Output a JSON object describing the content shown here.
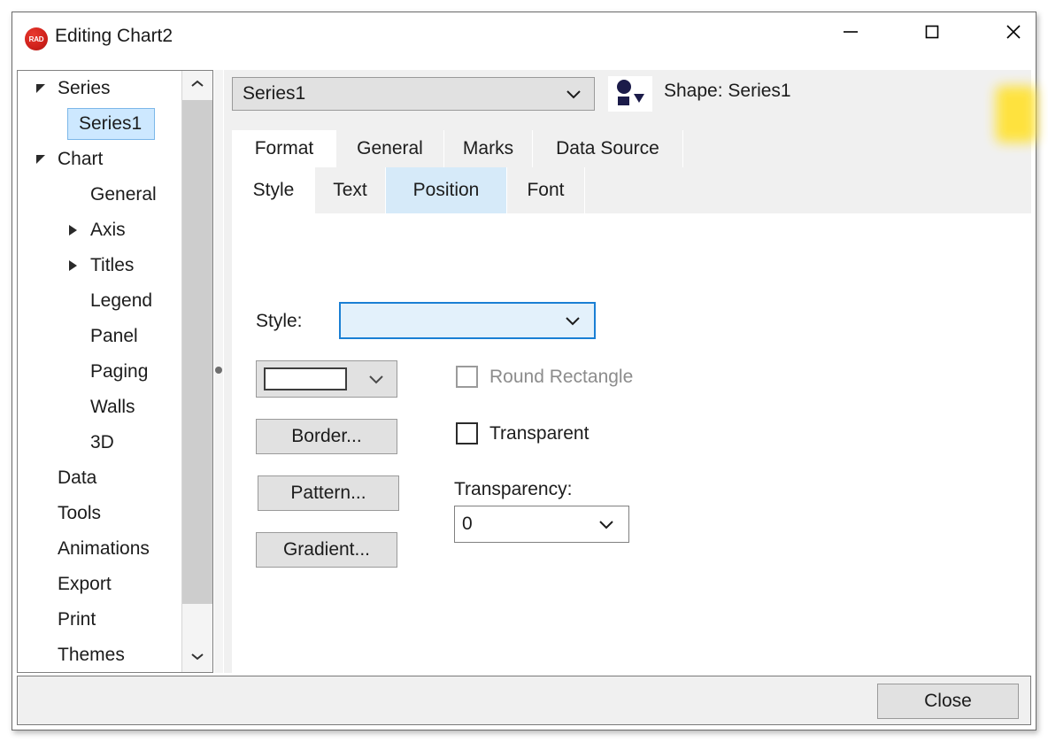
{
  "window": {
    "title": "Editing Chart2",
    "logo_text": "RAD",
    "controls": {
      "minimize": "minimize-icon",
      "maximize": "maximize-icon",
      "close": "close-icon"
    }
  },
  "tree": {
    "items": [
      {
        "label": "Series",
        "level": 0,
        "expander": "expanded",
        "selected": false
      },
      {
        "label": "Series1",
        "level": 1,
        "expander": "none",
        "selected": true
      },
      {
        "label": "Chart",
        "level": 0,
        "expander": "expanded",
        "selected": false
      },
      {
        "label": "General",
        "level": 1,
        "expander": "none",
        "selected": false
      },
      {
        "label": "Axis",
        "level": 1,
        "expander": "collapsed",
        "selected": false
      },
      {
        "label": "Titles",
        "level": 1,
        "expander": "collapsed",
        "selected": false
      },
      {
        "label": "Legend",
        "level": 1,
        "expander": "none",
        "selected": false
      },
      {
        "label": "Panel",
        "level": 1,
        "expander": "none",
        "selected": false
      },
      {
        "label": "Paging",
        "level": 1,
        "expander": "none",
        "selected": false
      },
      {
        "label": "Walls",
        "level": 1,
        "expander": "none",
        "selected": false
      },
      {
        "label": "3D",
        "level": 1,
        "expander": "none",
        "selected": false
      },
      {
        "label": "Data",
        "level": 0,
        "expander": "none",
        "selected": false
      },
      {
        "label": "Tools",
        "level": 0,
        "expander": "none",
        "selected": false
      },
      {
        "label": "Animations",
        "level": 0,
        "expander": "none",
        "selected": false
      },
      {
        "label": "Export",
        "level": 0,
        "expander": "none",
        "selected": false
      },
      {
        "label": "Print",
        "level": 0,
        "expander": "none",
        "selected": false
      },
      {
        "label": "Themes",
        "level": 0,
        "expander": "none",
        "selected": false
      }
    ]
  },
  "toolbar": {
    "series_select_value": "Series1",
    "shape_label": "Shape: Series1"
  },
  "tabs_primary": [
    {
      "label": "Format",
      "active": true
    },
    {
      "label": "General",
      "active": false
    },
    {
      "label": "Marks",
      "active": false
    },
    {
      "label": "Data Source",
      "active": false
    }
  ],
  "tabs_secondary": [
    {
      "label": "Style",
      "active": true,
      "hovered": false
    },
    {
      "label": "Text",
      "active": false,
      "hovered": false
    },
    {
      "label": "Position",
      "active": false,
      "hovered": true
    },
    {
      "label": "Font",
      "active": false,
      "hovered": false
    }
  ],
  "style_panel": {
    "style_label": "Style:",
    "style_value": "",
    "color_value": "",
    "buttons": {
      "border": "Border...",
      "pattern": "Pattern...",
      "gradient": "Gradient..."
    },
    "checkboxes": {
      "round_rectangle": {
        "label": "Round Rectangle",
        "checked": false,
        "enabled": false
      },
      "transparent": {
        "label": "Transparent",
        "checked": false,
        "enabled": true
      }
    },
    "transparency_label": "Transparency:",
    "transparency_value": "0"
  },
  "footer": {
    "close_label": "Close"
  },
  "colors": {
    "accent_blue": "#1a7fd4",
    "selection_blue": "#cde8ff",
    "hover_blue": "#d6eaf9",
    "button_face": "#e1e1e1",
    "panel_gray": "#f0f0f0",
    "logo_red": "#d0211b",
    "highlight_yellow": "#ffe235"
  }
}
